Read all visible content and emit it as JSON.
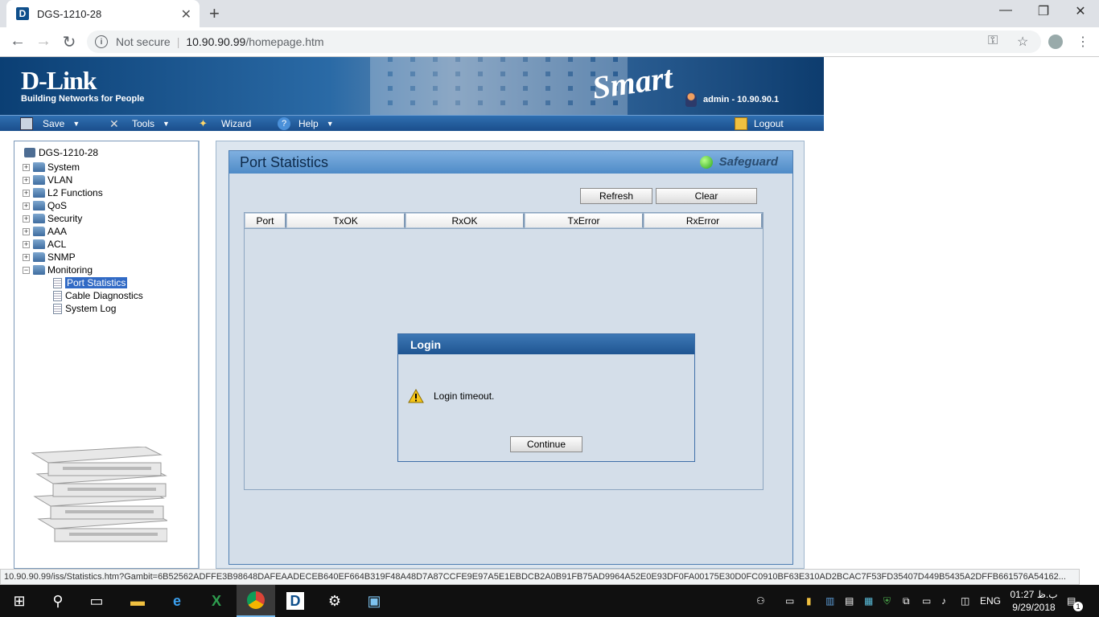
{
  "browser": {
    "tab_title": "DGS-1210-28",
    "tab_favicon_letter": "D",
    "security_label": "Not secure",
    "url_host": "10.90.90.99",
    "url_path": "/homepage.htm",
    "status_url": "10.90.90.99/iss/Statistics.htm?Gambit=6B52562ADFFE3B98648DAFEAADECEB640EF664B319F48A48D7A87CCFE9E97A5E1EBDCB2A0B91FB75AD9964A52E0E93DF0FA00175E30D0FC0910BF63E310AD2BCAC7F53FD35407D449B5435A2DFFB661576A54162..."
  },
  "banner": {
    "logo": "D-Link",
    "tagline": "Building Networks for People",
    "product": "Smart",
    "user_info": "admin - 10.90.90.1"
  },
  "menu": {
    "save": "Save",
    "tools": "Tools",
    "wizard": "Wizard",
    "help": "Help",
    "logout": "Logout"
  },
  "tree": {
    "root": "DGS-1210-28",
    "folders": [
      "System",
      "VLAN",
      "L2 Functions",
      "QoS",
      "Security",
      "AAA",
      "ACL",
      "SNMP",
      "Monitoring"
    ],
    "leaves": [
      "Port Statistics",
      "Cable Diagnostics",
      "System Log"
    ]
  },
  "panel": {
    "title": "Port Statistics",
    "safeguard": "Safeguard",
    "refresh_label": "Refresh",
    "clear_label": "Clear",
    "columns": [
      "Port",
      "TxOK",
      "RxOK",
      "TxError",
      "RxError"
    ]
  },
  "dialog": {
    "title": "Login",
    "message": "Login timeout.",
    "continue_label": "Continue"
  },
  "taskbar": {
    "language": "ENG",
    "time": "01:27 ب.ظ",
    "date": "9/29/2018",
    "notification_count": "1"
  }
}
